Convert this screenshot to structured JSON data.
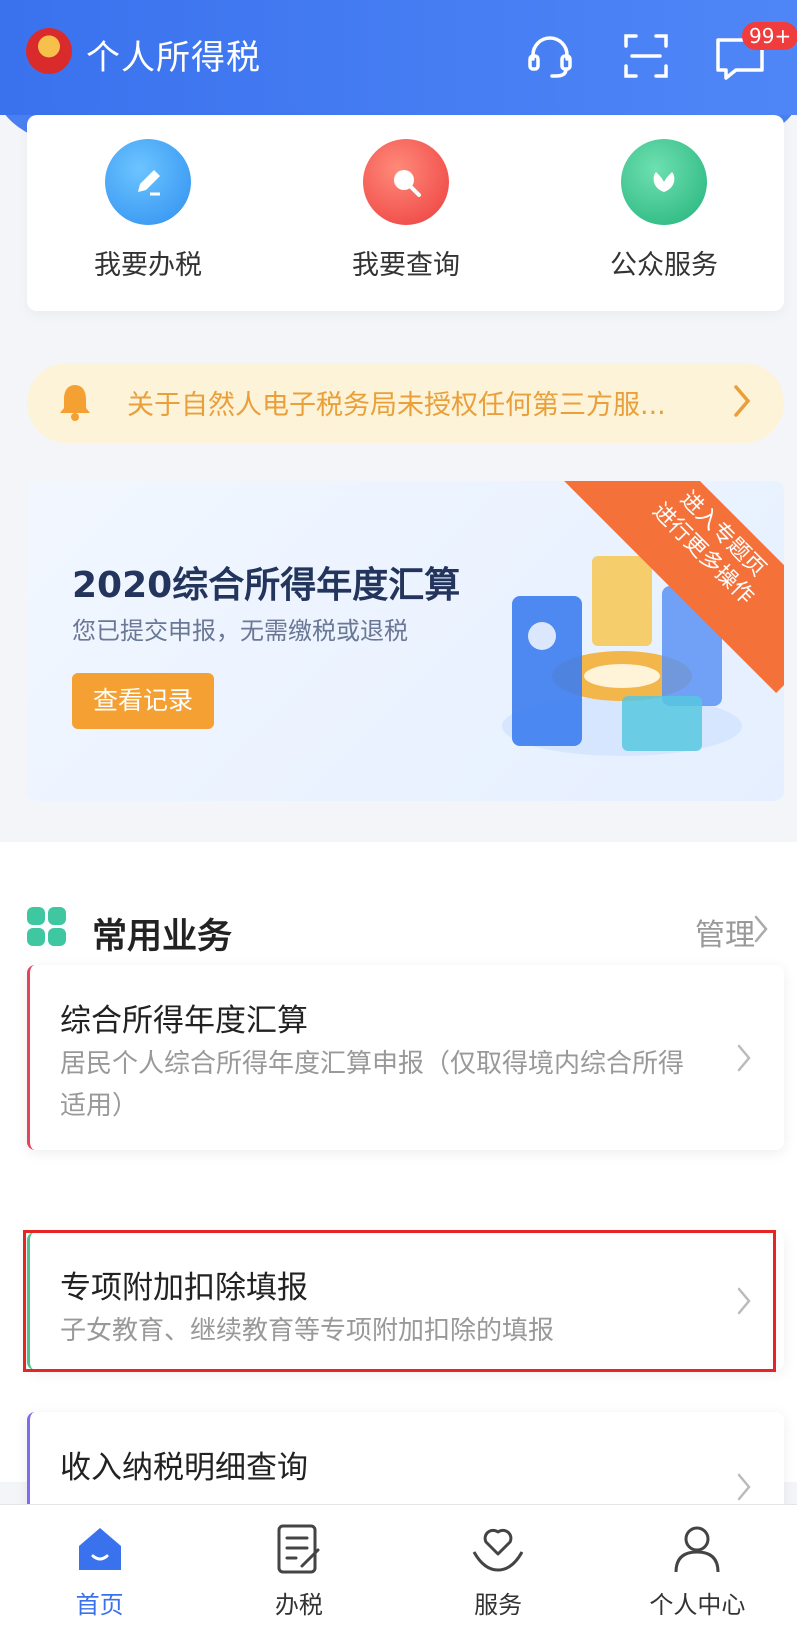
{
  "header": {
    "title": "个人所得税",
    "badge": "99+"
  },
  "quick_actions": [
    {
      "label": "我要办税",
      "icon": "pen-icon",
      "color": "#4aa8f4"
    },
    {
      "label": "我要查询",
      "icon": "search-icon",
      "color": "#f04d4d"
    },
    {
      "label": "公众服务",
      "icon": "leaf-icon",
      "color": "#3fc48f"
    }
  ],
  "notice": {
    "text": "关于自然人电子税务局未授权任何第三方服..."
  },
  "banner": {
    "title": "2020综合所得年度汇算",
    "subtitle": "您已提交申报，无需缴税或退税",
    "button": "查看记录",
    "ribbon_line1": "进入专题页",
    "ribbon_line2": "进行更多操作"
  },
  "common_business": {
    "title": "常用业务",
    "manage": "管理",
    "items": [
      {
        "title": "综合所得年度汇算",
        "desc": "居民个人综合所得年度汇算申报（仅取得境内综合所得适用）",
        "accent": "#e8425a"
      },
      {
        "title": "专项附加扣除填报",
        "desc": "子女教育、继续教育等专项附加扣除的填报",
        "accent": "#4cc48b"
      },
      {
        "title": "收入纳税明细查询",
        "desc": "",
        "accent": "#7b6cf0"
      }
    ]
  },
  "tabbar": [
    {
      "label": "首页",
      "icon": "home-icon",
      "active": true
    },
    {
      "label": "办税",
      "icon": "document-icon",
      "active": false
    },
    {
      "label": "服务",
      "icon": "heart-hand-icon",
      "active": false
    },
    {
      "label": "个人中心",
      "icon": "person-icon",
      "active": false
    }
  ],
  "colors": {
    "primary": "#3a72ee",
    "notice_text": "#e9a03a",
    "highlight": "#e62525"
  }
}
